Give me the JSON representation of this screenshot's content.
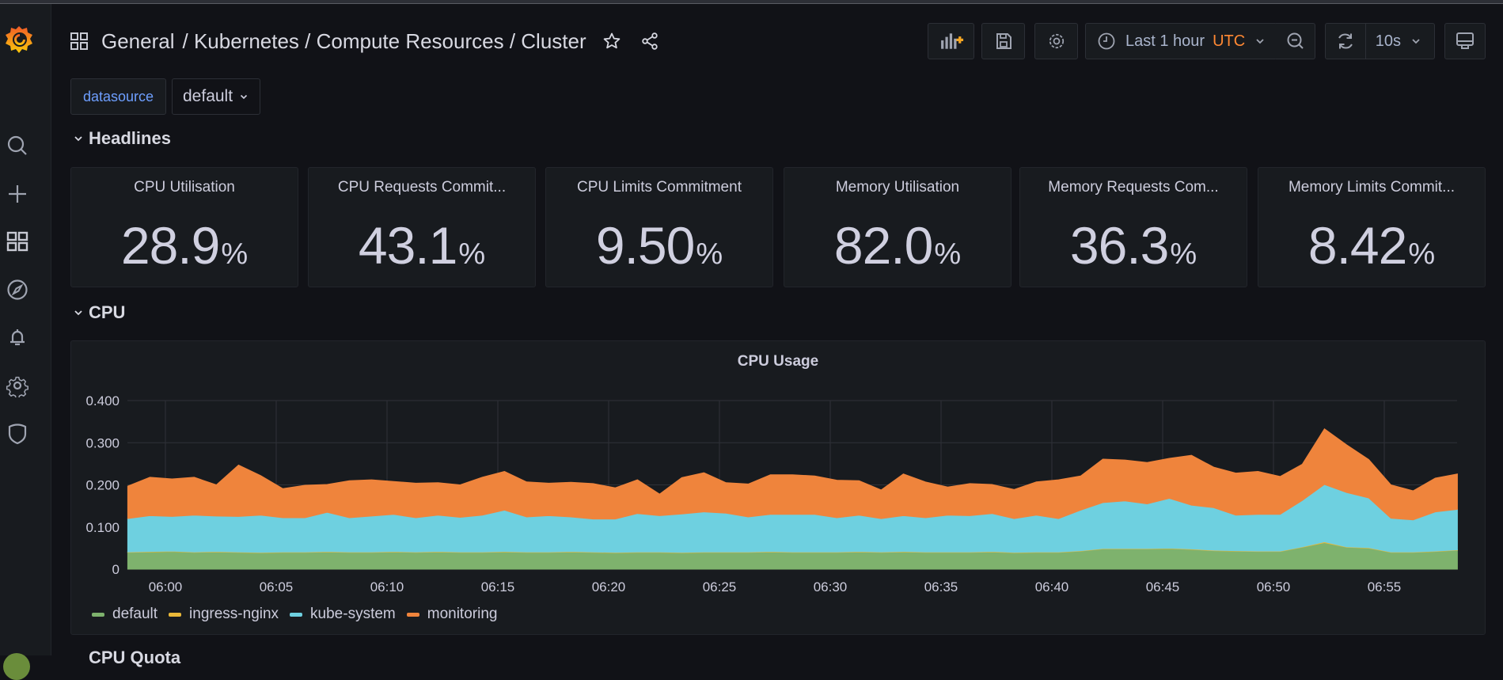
{
  "breadcrumb": {
    "folder": "General",
    "title": "/ Kubernetes / Compute Resources / Cluster"
  },
  "icons": {
    "logo": "grafana-logo",
    "sidebar": [
      "search-icon",
      "plus-icon",
      "dashboards-icon",
      "explore-compass-icon",
      "alert-bell-icon",
      "gear-icon",
      "shield-icon"
    ]
  },
  "toolbar": {
    "time_range": "Last 1 hour",
    "timezone": "UTC",
    "refresh_interval": "10s"
  },
  "variables": {
    "datasource_label": "datasource",
    "datasource_value": "default"
  },
  "rows": {
    "headlines": "Headlines",
    "cpu": "CPU",
    "next": "CPU Quota"
  },
  "stats": [
    {
      "title": "CPU Utilisation",
      "value": "28.9",
      "unit": "%"
    },
    {
      "title": "CPU Requests Commit...",
      "value": "43.1",
      "unit": "%"
    },
    {
      "title": "CPU Limits Commitment",
      "value": "9.50",
      "unit": "%"
    },
    {
      "title": "Memory Utilisation",
      "value": "82.0",
      "unit": "%"
    },
    {
      "title": "Memory Requests Com...",
      "value": "36.3",
      "unit": "%"
    },
    {
      "title": "Memory Limits Commit...",
      "value": "8.42",
      "unit": "%"
    }
  ],
  "chart_data": {
    "type": "area",
    "stacked": true,
    "title": "CPU Usage",
    "xlabel": "",
    "ylabel": "",
    "ylim": [
      0,
      0.4
    ],
    "yticks": [
      "0",
      "0.100",
      "0.200",
      "0.300",
      "0.400"
    ],
    "xticks": [
      "06:00",
      "06:05",
      "06:10",
      "06:15",
      "06:20",
      "06:25",
      "06:30",
      "06:35",
      "06:40",
      "06:45",
      "06:50",
      "06:55"
    ],
    "x_start_minute": -1.7,
    "x_step_minutes": 1,
    "grid": true,
    "legend": "bottom-left",
    "series": [
      {
        "name": "default",
        "color": "#7eb26d",
        "values": [
          0.04,
          0.041,
          0.042,
          0.04,
          0.041,
          0.04,
          0.039,
          0.04,
          0.04,
          0.041,
          0.04,
          0.04,
          0.041,
          0.04,
          0.041,
          0.04,
          0.04,
          0.041,
          0.04,
          0.04,
          0.041,
          0.04,
          0.039,
          0.04,
          0.04,
          0.039,
          0.04,
          0.04,
          0.04,
          0.041,
          0.04,
          0.04,
          0.04,
          0.041,
          0.04,
          0.041,
          0.04,
          0.04,
          0.04,
          0.041,
          0.039,
          0.04,
          0.04,
          0.043,
          0.048,
          0.048,
          0.048,
          0.049,
          0.047,
          0.044,
          0.043,
          0.042,
          0.042,
          0.052,
          0.063,
          0.052,
          0.05,
          0.04,
          0.04,
          0.042,
          0.045
        ]
      },
      {
        "name": "ingress-nginx",
        "color": "#eab839",
        "values": [
          0.001,
          0.001,
          0.001,
          0.001,
          0.001,
          0.001,
          0.001,
          0.001,
          0.001,
          0.001,
          0.001,
          0.001,
          0.001,
          0.001,
          0.001,
          0.001,
          0.001,
          0.001,
          0.001,
          0.001,
          0.001,
          0.001,
          0.001,
          0.001,
          0.001,
          0.001,
          0.001,
          0.001,
          0.001,
          0.001,
          0.001,
          0.001,
          0.001,
          0.001,
          0.001,
          0.001,
          0.001,
          0.001,
          0.001,
          0.001,
          0.001,
          0.001,
          0.001,
          0.001,
          0.001,
          0.001,
          0.001,
          0.001,
          0.001,
          0.001,
          0.001,
          0.001,
          0.001,
          0.001,
          0.002,
          0.001,
          0.001,
          0.001,
          0.001,
          0.001,
          0.001
        ]
      },
      {
        "name": "kube-system",
        "color": "#6ed0e0",
        "values": [
          0.079,
          0.085,
          0.082,
          0.087,
          0.084,
          0.084,
          0.088,
          0.081,
          0.081,
          0.093,
          0.081,
          0.085,
          0.088,
          0.081,
          0.086,
          0.082,
          0.087,
          0.098,
          0.083,
          0.086,
          0.082,
          0.078,
          0.079,
          0.091,
          0.086,
          0.091,
          0.095,
          0.092,
          0.083,
          0.088,
          0.089,
          0.089,
          0.081,
          0.086,
          0.079,
          0.085,
          0.081,
          0.087,
          0.086,
          0.09,
          0.08,
          0.087,
          0.079,
          0.096,
          0.109,
          0.113,
          0.106,
          0.118,
          0.104,
          0.101,
          0.084,
          0.087,
          0.087,
          0.11,
          0.136,
          0.129,
          0.118,
          0.08,
          0.076,
          0.093,
          0.096
        ]
      },
      {
        "name": "monitoring",
        "color": "#ef843c",
        "values": [
          0.077,
          0.091,
          0.089,
          0.09,
          0.074,
          0.122,
          0.094,
          0.069,
          0.077,
          0.066,
          0.088,
          0.086,
          0.078,
          0.082,
          0.077,
          0.077,
          0.09,
          0.092,
          0.083,
          0.077,
          0.082,
          0.084,
          0.074,
          0.08,
          0.051,
          0.086,
          0.093,
          0.072,
          0.078,
          0.094,
          0.094,
          0.091,
          0.089,
          0.082,
          0.068,
          0.099,
          0.085,
          0.067,
          0.076,
          0.069,
          0.069,
          0.079,
          0.092,
          0.081,
          0.103,
          0.097,
          0.098,
          0.095,
          0.118,
          0.096,
          0.1,
          0.102,
          0.09,
          0.086,
          0.132,
          0.113,
          0.091,
          0.079,
          0.069,
          0.08,
          0.084
        ]
      }
    ]
  }
}
